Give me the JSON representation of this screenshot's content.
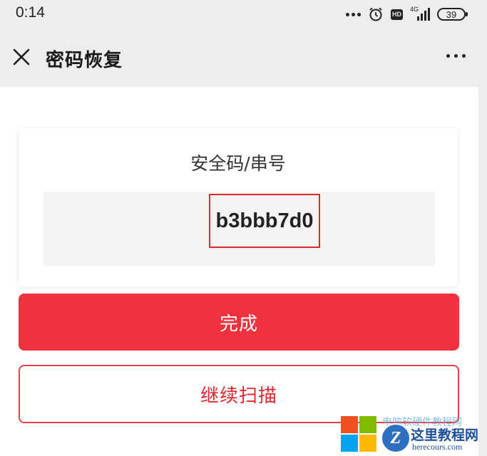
{
  "status_bar": {
    "time": "0:14",
    "network_label": "4G",
    "hd_label": "HD",
    "battery_level": "39"
  },
  "header": {
    "title": "密码恢复"
  },
  "card": {
    "title": "安全码/串号",
    "security_code": "b3bbb7d0"
  },
  "actions": {
    "done_label": "完成",
    "continue_scan_label": "继续扫描"
  },
  "watermark": {
    "top_text": "电脑软硬件教程网",
    "badge_letter": "Z",
    "site_name": "这里教程网",
    "url": "herecours.com"
  },
  "colors": {
    "primary_red": "#f0323f",
    "highlight_border": "#e0262e",
    "background": "#ededed"
  }
}
